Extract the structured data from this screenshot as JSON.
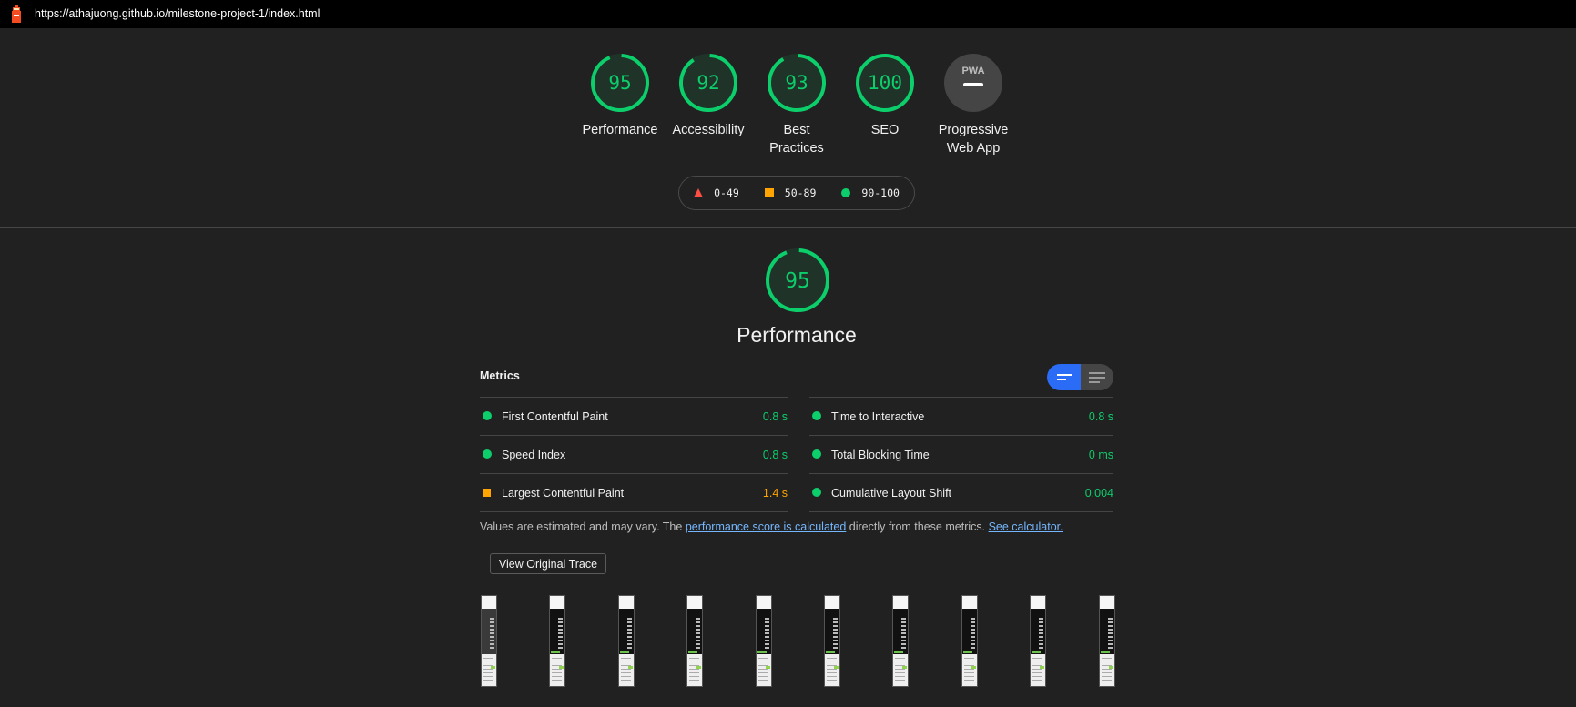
{
  "topbar": {
    "logo_icon": "lighthouse-icon",
    "url": "https://athajuong.github.io/milestone-project-1/index.html"
  },
  "categories": [
    {
      "id": "performance",
      "label": "Performance",
      "score": 95,
      "display": "95"
    },
    {
      "id": "accessibility",
      "label": "Accessibility",
      "score": 92,
      "display": "92"
    },
    {
      "id": "best-practices",
      "label": "Best Practices",
      "score": 93,
      "display": "93"
    },
    {
      "id": "seo",
      "label": "SEO",
      "score": 100,
      "display": "100"
    },
    {
      "id": "pwa",
      "label": "Progressive Web App",
      "badge": "PWA",
      "score": null
    }
  ],
  "legend": [
    {
      "icon": "triangle-icon",
      "range": "0-49",
      "color": "#ff4e42"
    },
    {
      "icon": "square-icon",
      "range": "50-89",
      "color": "#ffa400"
    },
    {
      "icon": "circle-icon",
      "range": "90-100",
      "color": "#0cce6b"
    }
  ],
  "performance": {
    "score": 95,
    "display": "95",
    "title": "Performance",
    "metrics_label": "Metrics",
    "toggle": {
      "active": "compact",
      "options": [
        "compact-view",
        "expanded-view"
      ]
    },
    "metrics_left": [
      {
        "name": "First Contentful Paint",
        "value": "0.8 s",
        "rating": "pass"
      },
      {
        "name": "Speed Index",
        "value": "0.8 s",
        "rating": "pass"
      },
      {
        "name": "Largest Contentful Paint",
        "value": "1.4 s",
        "rating": "average"
      }
    ],
    "metrics_right": [
      {
        "name": "Time to Interactive",
        "value": "0.8 s",
        "rating": "pass"
      },
      {
        "name": "Total Blocking Time",
        "value": "0 ms",
        "rating": "pass"
      },
      {
        "name": "Cumulative Layout Shift",
        "value": "0.004",
        "rating": "pass"
      }
    ],
    "note": {
      "prefix": "Values are estimated and may vary. The ",
      "link1": "performance score is calculated",
      "middle": " directly from these metrics. ",
      "link2": "See calculator."
    },
    "trace_button": "View Original Trace",
    "filmstrip_count": 10
  },
  "colors": {
    "pass": "#0cce6b",
    "average": "#ffa400",
    "fail": "#ff4e42",
    "link": "#75b7ff",
    "toggle_active": "#2b6cf6"
  }
}
